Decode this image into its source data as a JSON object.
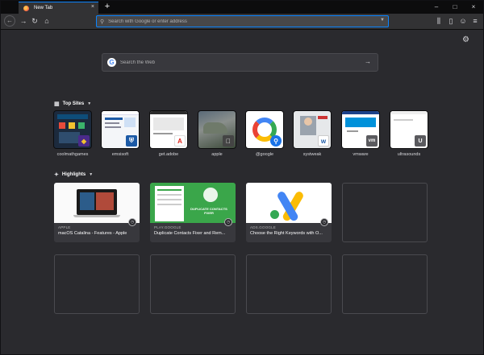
{
  "tab": {
    "title": "New Tab",
    "close": "×",
    "new": "+"
  },
  "window_controls": {
    "minimize": "–",
    "maximize": "□",
    "close": "×"
  },
  "nav": {
    "back": "←",
    "forward": "→",
    "reload": "↻",
    "home": "⌂",
    "library": "⫼",
    "sidebar": "▯",
    "account": "☺",
    "menu": "≡"
  },
  "urlbar": {
    "placeholder": "Search with Google or enter address"
  },
  "search": {
    "placeholder": "Search the Web",
    "logo": "G"
  },
  "top_sites": {
    "heading": "Top Sites",
    "sites": [
      {
        "label": "coolmathgames"
      },
      {
        "label": "emsisoft"
      },
      {
        "label": "get.adobe"
      },
      {
        "label": "apple"
      },
      {
        "label": "@google"
      },
      {
        "label": "systweak"
      },
      {
        "label": "vmware"
      },
      {
        "label": "ultrasounds"
      }
    ]
  },
  "highlights": {
    "heading": "Highlights",
    "cards": [
      {
        "source": "APPLE",
        "title": "macOS Catalina - Features - Apple"
      },
      {
        "source": "PLAY.GOOGLE",
        "title": "Duplicate Contacts Fixer and Rem..."
      },
      {
        "source": "ADS.GOOGLE",
        "title": "Choose the Right Keywords with O..."
      }
    ]
  },
  "thumb_text": {
    "dup_banner": "DUPLICATE CONTACTS FIXER",
    "vm_badge": "vm",
    "u_badge": "U"
  },
  "colors": {
    "accent": "#0a84ff",
    "bg": "#2a2a2e",
    "card": "#38383d"
  }
}
